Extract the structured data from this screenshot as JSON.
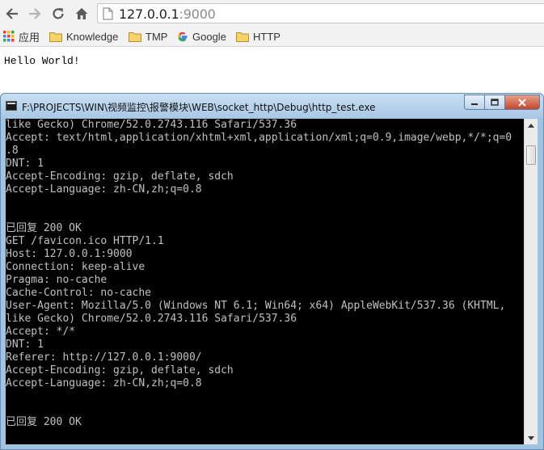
{
  "browser": {
    "url_host": "127.0.0.1",
    "url_port": ":9000"
  },
  "bookmarks": {
    "items": [
      {
        "label": "应用",
        "icon": "apps-grid-icon"
      },
      {
        "label": "Knowledge",
        "icon": "folder-icon"
      },
      {
        "label": "TMP",
        "icon": "folder-icon"
      },
      {
        "label": "Google",
        "icon": "google-icon"
      },
      {
        "label": "HTTP",
        "icon": "folder-icon"
      }
    ]
  },
  "page": {
    "text": "Hello World!"
  },
  "console": {
    "title": "F:\\PROJECTS\\WIN\\视频监控\\报警模块\\WEB\\socket_http\\Debug\\http_test.exe",
    "lines": [
      "like Gecko) Chrome/52.0.2743.116 Safari/537.36",
      "Accept: text/html,application/xhtml+xml,application/xml;q=0.9,image/webp,*/*;q=0",
      ".8",
      "DNT: 1",
      "Accept-Encoding: gzip, deflate, sdch",
      "Accept-Language: zh-CN,zh;q=0.8",
      "",
      "",
      "已回复 200 OK",
      "GET /favicon.ico HTTP/1.1",
      "Host: 127.0.0.1:9000",
      "Connection: keep-alive",
      "Pragma: no-cache",
      "Cache-Control: no-cache",
      "User-Agent: Mozilla/5.0 (Windows NT 6.1; Win64; x64) AppleWebKit/537.36 (KHTML,",
      "like Gecko) Chrome/52.0.2743.116 Safari/537.36",
      "Accept: */*",
      "DNT: 1",
      "Referer: http://127.0.0.1:9000/",
      "Accept-Encoding: gzip, deflate, sdch",
      "Accept-Language: zh-CN,zh;q=0.8",
      "",
      "",
      "已回复 200 OK",
      ""
    ]
  },
  "colors": {
    "console_bg": "#000000",
    "console_text": "#c0c0c0",
    "titlebar": "#b4d0ea",
    "close_button": "#c3462a"
  }
}
